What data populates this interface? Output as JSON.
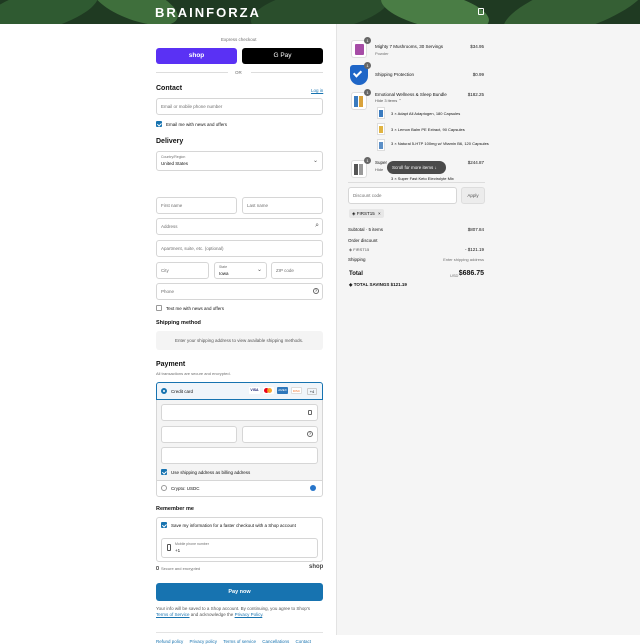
{
  "brand": {
    "logo": "BRAINFORZA"
  },
  "express": {
    "label": "Express checkout",
    "shop_label": "shop",
    "gpay_label": "G Pay",
    "or_label": "OR"
  },
  "contact": {
    "heading": "Contact",
    "login_label": "Log in",
    "email_placeholder": "Email or mobile phone number",
    "news_label": "Email me with news and offers"
  },
  "delivery": {
    "heading": "Delivery",
    "country_label": "Country/Region",
    "country_value": "United States",
    "first_name_placeholder": "First name",
    "last_name_placeholder": "Last name",
    "address_placeholder": "Address",
    "apartment_placeholder": "Apartment, suite, etc. (optional)",
    "city_placeholder": "City",
    "state_label": "State",
    "state_value": "Iowa",
    "zip_placeholder": "ZIP code",
    "phone_placeholder": "Phone",
    "text_label": "Text me with news and offers"
  },
  "shipping_method": {
    "heading": "Shipping method",
    "notice": "Enter your shipping address to view available shipping methods."
  },
  "payment": {
    "heading": "Payment",
    "subtitle": "All transactions are secure and encrypted.",
    "credit_card_label": "Credit card",
    "more_cards_label": "+4",
    "billing_label": "Use shipping address as billing address",
    "crypto_label": "Crypto: USDC"
  },
  "remember": {
    "heading": "Remember me",
    "save_label": "Save my information for a faster checkout with a Shop account",
    "mobile_label": "Mobile phone number",
    "mobile_value": "+1",
    "secure_label": "Secure and encrypted",
    "shop_label": "shop"
  },
  "pay": {
    "button_label": "Pay now",
    "disclaimer_1": "Your info will be saved to a Shop account. By continuing, you agree to Shop's",
    "terms_link": "Terms of Service",
    "disclaimer_2": "and acknowledge the",
    "privacy_link": "Privacy Policy",
    "period": "."
  },
  "footer": {
    "links": [
      "Refund policy",
      "Privacy policy",
      "Terms of service",
      "Cancellations",
      "Contact"
    ]
  },
  "order": {
    "items": [
      {
        "name": "Mighty 7 Mushrooms, 30 Servings",
        "variant": "Powder",
        "price": "$34.95",
        "qty": "1"
      },
      {
        "name": "Shipping Protection",
        "variant": "",
        "price": "$0.99",
        "qty": "1"
      },
      {
        "name": "Emotional Wellness & Sleep Bundle",
        "variant": "Hide 3 items",
        "price": "$182.25",
        "qty": "1"
      },
      {
        "name": "Super",
        "variant": "Hide",
        "price": "$244.87",
        "qty": "1"
      }
    ],
    "bundle_items": [
      "3 × Adapt All Adaptogen, 180 Capsules",
      "3 × Lemon Balm PE Extract, 90 Capsules",
      "3 × Natural 5-HTP 100mg w/ Vitamin B6, 120 Capsules"
    ],
    "partial_item": "3 × Super Fast Keto Electrolyte Mix",
    "scroll_hint": "Scroll for more items",
    "discount_placeholder": "Discount code",
    "apply_label": "Apply",
    "discount_tag": "FIRST15",
    "subtotal_label": "Subtotal · 5 items",
    "subtotal_value": "$807.84",
    "order_discount_label": "Order discount",
    "discount_code_label": "FIRST15",
    "discount_value": "- $121.19",
    "shipping_label": "Shipping",
    "shipping_value": "Enter shipping address",
    "total_label": "Total",
    "currency": "USD",
    "total_value": "$686.75",
    "savings_label": "TOTAL SAVINGS",
    "savings_value": "$121.19"
  },
  "colors": {
    "accent": "#1773b0",
    "shop_purple": "#5a31f4",
    "pay_button": "#1773b0"
  }
}
